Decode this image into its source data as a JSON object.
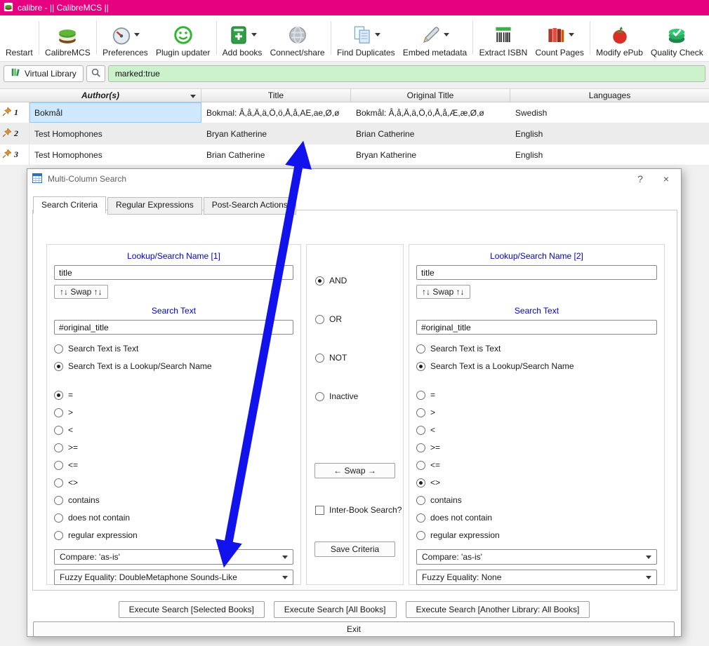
{
  "window": {
    "title": "calibre - || CalibreMCS ||"
  },
  "colors": {
    "titlebar": "#e5017f",
    "search_highlight": "#ccf2cc",
    "selected_cell": "#cde8ff",
    "dialog_label_blue": "#0202c8"
  },
  "toolbar": {
    "items": [
      {
        "label": "Restart",
        "has_dropdown": false
      },
      {
        "label": "CalibreMCS",
        "has_dropdown": false
      },
      {
        "label": "Preferences",
        "has_dropdown": true
      },
      {
        "label": "Plugin updater",
        "has_dropdown": false
      },
      {
        "label": "Add books",
        "has_dropdown": true
      },
      {
        "label": "Connect/share",
        "has_dropdown": false
      },
      {
        "label": "Find Duplicates",
        "has_dropdown": true
      },
      {
        "label": "Embed metadata",
        "has_dropdown": true
      },
      {
        "label": "Extract ISBN",
        "has_dropdown": false
      },
      {
        "label": "Count Pages",
        "has_dropdown": true
      },
      {
        "label": "Modify ePub",
        "has_dropdown": false
      },
      {
        "label": "Quality Check",
        "has_dropdown": false
      }
    ]
  },
  "search_area": {
    "virtual_library_label": "Virtual Library",
    "search_value": "marked:true"
  },
  "book_table": {
    "headers": {
      "authors": "Author(s)",
      "title": "Title",
      "original_title": "Original Title",
      "languages": "Languages"
    },
    "rows": [
      {
        "num": "1",
        "authors": "Bokmål",
        "title": "Bokmal: Â,å,Ä,ä,Ö,ö,Å,å,AE,ae,Ø,ø",
        "original_title": "Bokmål: Â,å,Ä,ä,Ö,ö,Å,å,Æ,æ,Ø,ø",
        "languages": "Swedish"
      },
      {
        "num": "2",
        "authors": "Test Homophones",
        "title": "Bryan Katherine",
        "original_title": "Brian Catherine",
        "languages": "English"
      },
      {
        "num": "3",
        "authors": "Test Homophones",
        "title": "Brian Catherine",
        "original_title": "Bryan Katherine",
        "languages": "English"
      }
    ]
  },
  "dialog": {
    "title": "Multi-Column Search",
    "help_button": "?",
    "close_button": "×",
    "tabs": [
      {
        "label": "Search Criteria",
        "active": true
      },
      {
        "label": "Regular Expressions",
        "active": false
      },
      {
        "label": "Post-Search Actions",
        "active": false
      }
    ],
    "comparison_ops": [
      "=",
      ">",
      "<",
      ">=",
      "<=",
      "<>",
      "contains",
      "does not contain",
      "regular expression"
    ],
    "left": {
      "group_title": "Lookup/Search Name [1]",
      "lookup_value": "title",
      "swap_label": "↑↓ Swap ↑↓",
      "search_text_title": "Search Text",
      "search_text_value": "#original_title",
      "text_type_options": [
        "Search Text is Text",
        "Search Text is a Lookup/Search Name"
      ],
      "text_type_selected": "Search Text is a Lookup/Search Name",
      "selected_op": "=",
      "compare_value": "Compare: 'as-is'",
      "fuzzy_value": "Fuzzy Equality: DoubleMetaphone Sounds-Like"
    },
    "middle": {
      "logic_options": [
        "AND",
        "OR",
        "NOT",
        "Inactive"
      ],
      "logic_selected": "AND",
      "swap_label": "← Swap →",
      "inter_book_label": "Inter-Book Search?",
      "inter_book_checked": false,
      "save_label": "Save Criteria"
    },
    "right": {
      "group_title": "Lookup/Search Name [2]",
      "lookup_value": "title",
      "swap_label": "↑↓ Swap ↑↓",
      "search_text_title": "Search Text",
      "search_text_value": "#original_title",
      "text_type_options": [
        "Search Text is Text",
        "Search Text is a Lookup/Search Name"
      ],
      "text_type_selected": "Search Text is a Lookup/Search Name",
      "selected_op": "<>",
      "compare_value": "Compare: 'as-is'",
      "fuzzy_value": "Fuzzy Equality: None"
    },
    "execute_buttons": [
      "Execute Search [Selected Books]",
      "Execute Search [All Books]",
      "Execute Search [Another Library: All Books]"
    ],
    "exit_label": "Exit"
  },
  "annotation": {
    "arrow_color": "#1212ec"
  }
}
